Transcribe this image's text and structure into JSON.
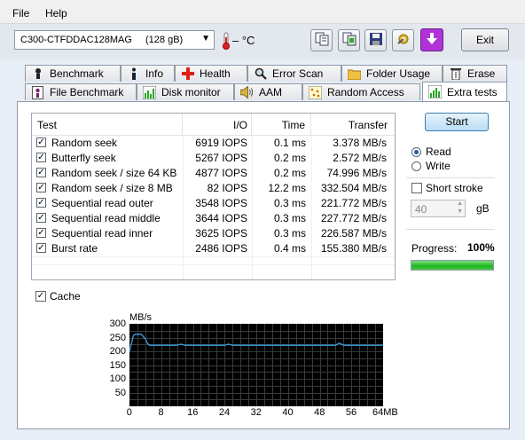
{
  "menu": {
    "file": "File",
    "help": "Help"
  },
  "toolbar": {
    "drive": "C300-CTFDDAC128MAG",
    "capacity": "(128 gB)",
    "temperature": "– °C",
    "exit_label": "Exit",
    "icons": [
      "copy-text-icon",
      "copy-screenshot-icon",
      "save-icon",
      "options-icon",
      "download-icon"
    ]
  },
  "tabs_top": [
    {
      "label": "Benchmark",
      "icon": "benchmark-icon"
    },
    {
      "label": "Info",
      "icon": "info-icon"
    },
    {
      "label": "Health",
      "icon": "health-icon"
    },
    {
      "label": "Error Scan",
      "icon": "error-scan-icon"
    },
    {
      "label": "Folder Usage",
      "icon": "folder-icon"
    },
    {
      "label": "Erase",
      "icon": "erase-icon"
    }
  ],
  "tabs_bottom": [
    {
      "label": "File Benchmark",
      "icon": "file-benchmark-icon"
    },
    {
      "label": "Disk monitor",
      "icon": "disk-monitor-icon"
    },
    {
      "label": "AAM",
      "icon": "speaker-icon"
    },
    {
      "label": "Random Access",
      "icon": "random-access-icon"
    },
    {
      "label": "Extra tests",
      "icon": "extra-tests-icon",
      "active": true
    }
  ],
  "results": {
    "headers": {
      "test": "Test",
      "io": "I/O",
      "time": "Time",
      "transfer": "Transfer"
    },
    "rows": [
      {
        "test": "Random seek",
        "io": "6919 IOPS",
        "time": "0.1 ms",
        "transfer": "3.378 MB/s",
        "checked": true
      },
      {
        "test": "Butterfly seek",
        "io": "5267 IOPS",
        "time": "0.2 ms",
        "transfer": "2.572 MB/s",
        "checked": true
      },
      {
        "test": "Random seek / size 64 KB",
        "io": "4877 IOPS",
        "time": "0.2 ms",
        "transfer": "74.996 MB/s",
        "checked": true
      },
      {
        "test": "Random seek / size 8 MB",
        "io": "82 IOPS",
        "time": "12.2 ms",
        "transfer": "332.504 MB/s",
        "checked": true
      },
      {
        "test": "Sequential read outer",
        "io": "3548 IOPS",
        "time": "0.3 ms",
        "transfer": "221.772 MB/s",
        "checked": true
      },
      {
        "test": "Sequential read middle",
        "io": "3644 IOPS",
        "time": "0.3 ms",
        "transfer": "227.772 MB/s",
        "checked": true
      },
      {
        "test": "Sequential read inner",
        "io": "3625 IOPS",
        "time": "0.3 ms",
        "transfer": "226.587 MB/s",
        "checked": true
      },
      {
        "test": "Burst rate",
        "io": "2486 IOPS",
        "time": "0.4 ms",
        "transfer": "155.380 MB/s",
        "checked": true
      }
    ]
  },
  "controls": {
    "start_label": "Start",
    "read_label": "Read",
    "write_label": "Write",
    "mode": "read",
    "short_stroke_label": "Short stroke",
    "short_stroke_checked": false,
    "short_stroke_value": "40",
    "short_stroke_unit": "gB",
    "progress_label": "Progress:",
    "progress_value": "100%",
    "progress_fraction": 1.0,
    "cache_label": "Cache",
    "cache_checked": true
  },
  "chart_data": {
    "type": "line",
    "ylabel": "MB/s",
    "xunit": "MB",
    "ylim": [
      0,
      300
    ],
    "xlim": [
      0,
      64
    ],
    "yticks": [
      50,
      100,
      150,
      200,
      250,
      300
    ],
    "yticks_labels": [
      "50",
      "100",
      "150",
      "200",
      "250",
      "300"
    ],
    "xticks": [
      0,
      8,
      16,
      24,
      32,
      40,
      48,
      56,
      64
    ],
    "xticks_labels": [
      "0",
      "8",
      "16",
      "24",
      "32",
      "40",
      "48",
      "56",
      "64MB"
    ],
    "grid": true,
    "line_color": "#3aa0e0",
    "x": [
      0,
      0.5,
      1,
      1.5,
      2,
      3,
      4,
      4.5,
      5,
      6,
      8,
      10,
      12,
      13,
      14,
      16,
      18,
      20,
      24,
      25,
      26,
      28,
      32,
      36,
      40,
      44,
      48,
      52,
      53,
      54,
      56,
      60,
      62,
      64
    ],
    "y": [
      200,
      228,
      258,
      262,
      262,
      262,
      245,
      230,
      222,
      222,
      222,
      222,
      222,
      226,
      222,
      222,
      222,
      222,
      222,
      226,
      222,
      222,
      222,
      222,
      222,
      222,
      222,
      222,
      230,
      222,
      222,
      222,
      222,
      222
    ]
  }
}
